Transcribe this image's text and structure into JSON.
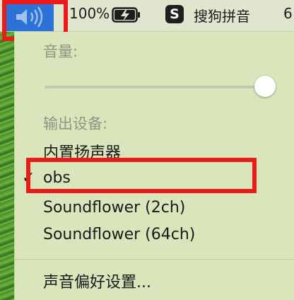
{
  "menubar": {
    "battery_percent": "100%",
    "input_method_icon": "S",
    "input_method_name": "搜狗拼音",
    "clock_partial": "6"
  },
  "menu": {
    "volume_label": "音量:",
    "volume_level": 0.95,
    "output_label": "输出设备:",
    "devices": [
      {
        "label": "内置扬声器",
        "selected": false
      },
      {
        "label": "obs",
        "selected": true
      },
      {
        "label": "Soundflower (2ch)",
        "selected": false
      },
      {
        "label": "Soundflower (64ch)",
        "selected": false
      }
    ],
    "check_mark": "✓",
    "preferences_label": "声音偏好设置..."
  },
  "colors": {
    "highlight_box": "#ec1a1a",
    "volume_icon_bg": "#2d72d6"
  }
}
